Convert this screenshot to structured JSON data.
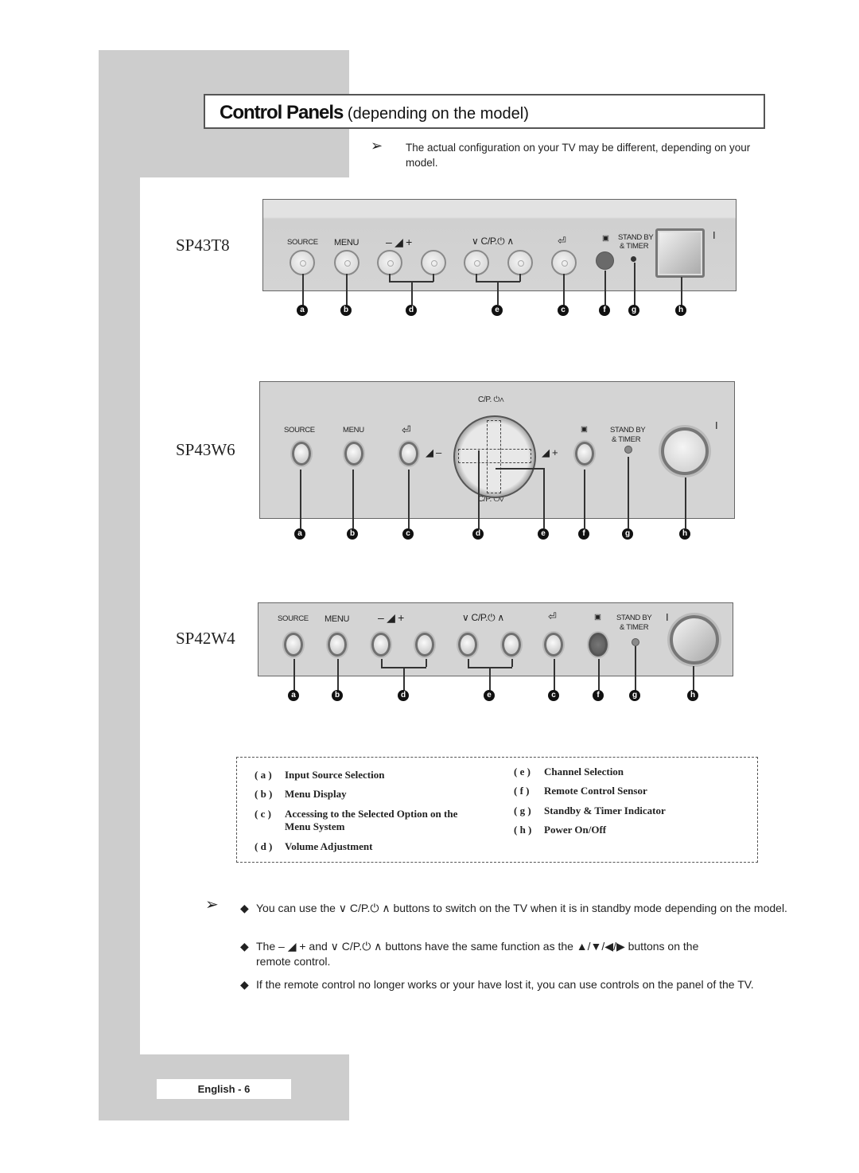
{
  "header": {
    "title_bold": "Control Panels",
    "title_rest": " (depending on the model)",
    "note_arrow": "➢",
    "note": "The actual configuration on your TV may be different, depending on your model."
  },
  "panels": [
    {
      "model": "SP43T8",
      "labels": {
        "source": "SOURCE",
        "menu": "MENU",
        "vol": "–  ◢  +",
        "ch": "∨  C/P.⏻  ∧",
        "enter": "⏎",
        "sensor": "▣",
        "standby": "STAND BY",
        "timer": "& TIMER",
        "power_mark": "I"
      },
      "callouts": [
        "a",
        "b",
        "d",
        "e",
        "c",
        "f",
        "g",
        "h"
      ]
    },
    {
      "model": "SP43W6",
      "labels": {
        "source": "SOURCE",
        "menu": "MENU",
        "enter": "⏎",
        "ch_up": "C/P. ⏻∧",
        "ch_down": "C/P. ⏻∨",
        "vol_minus": "◢ –",
        "vol_plus": "◢ +",
        "sensor": "▣",
        "standby": "STAND BY",
        "timer": "& TIMER",
        "power_mark": "I"
      },
      "callouts": [
        "a",
        "b",
        "c",
        "d",
        "e",
        "f",
        "g",
        "h"
      ]
    },
    {
      "model": "SP42W4",
      "labels": {
        "source": "SOURCE",
        "menu": "MENU",
        "vol": "–  ◢  +",
        "ch": "∨  C/P.⏻  ∧",
        "enter": "⏎",
        "sensor": "▣",
        "standby": "STAND BY",
        "timer": "& TIMER",
        "power_mark": "I"
      },
      "callouts": [
        "a",
        "b",
        "d",
        "e",
        "c",
        "f",
        "g",
        "h"
      ]
    }
  ],
  "legend": [
    {
      "key": "( a )",
      "text": "Input Source Selection"
    },
    {
      "key": "( b )",
      "text": "Menu Display"
    },
    {
      "key": "( c )",
      "text": "Accessing to the Selected Option on the Menu System"
    },
    {
      "key": "( d )",
      "text": "Volume Adjustment"
    },
    {
      "key": "( e )",
      "text": "Channel Selection"
    },
    {
      "key": "( f )",
      "text": "Remote Control Sensor"
    },
    {
      "key": "( g )",
      "text": "Standby & Timer Indicator"
    },
    {
      "key": "( h )",
      "text": "Power On/Off"
    }
  ],
  "notes": {
    "arrow": "➢",
    "diamond": "◆",
    "items": [
      "You can use the ∨ C/P.⏻ ∧ buttons to switch on the TV when it is in standby mode depending on the model.",
      "The – ◢ + and ∨ C/P.⏻ ∧ buttons have the same function as the ▲/▼/◀/▶ buttons on the remote control.",
      "If the remote control no longer works or your have lost it, you can use controls on the panel of the TV."
    ]
  },
  "footer": {
    "page_label": "English - 6"
  }
}
